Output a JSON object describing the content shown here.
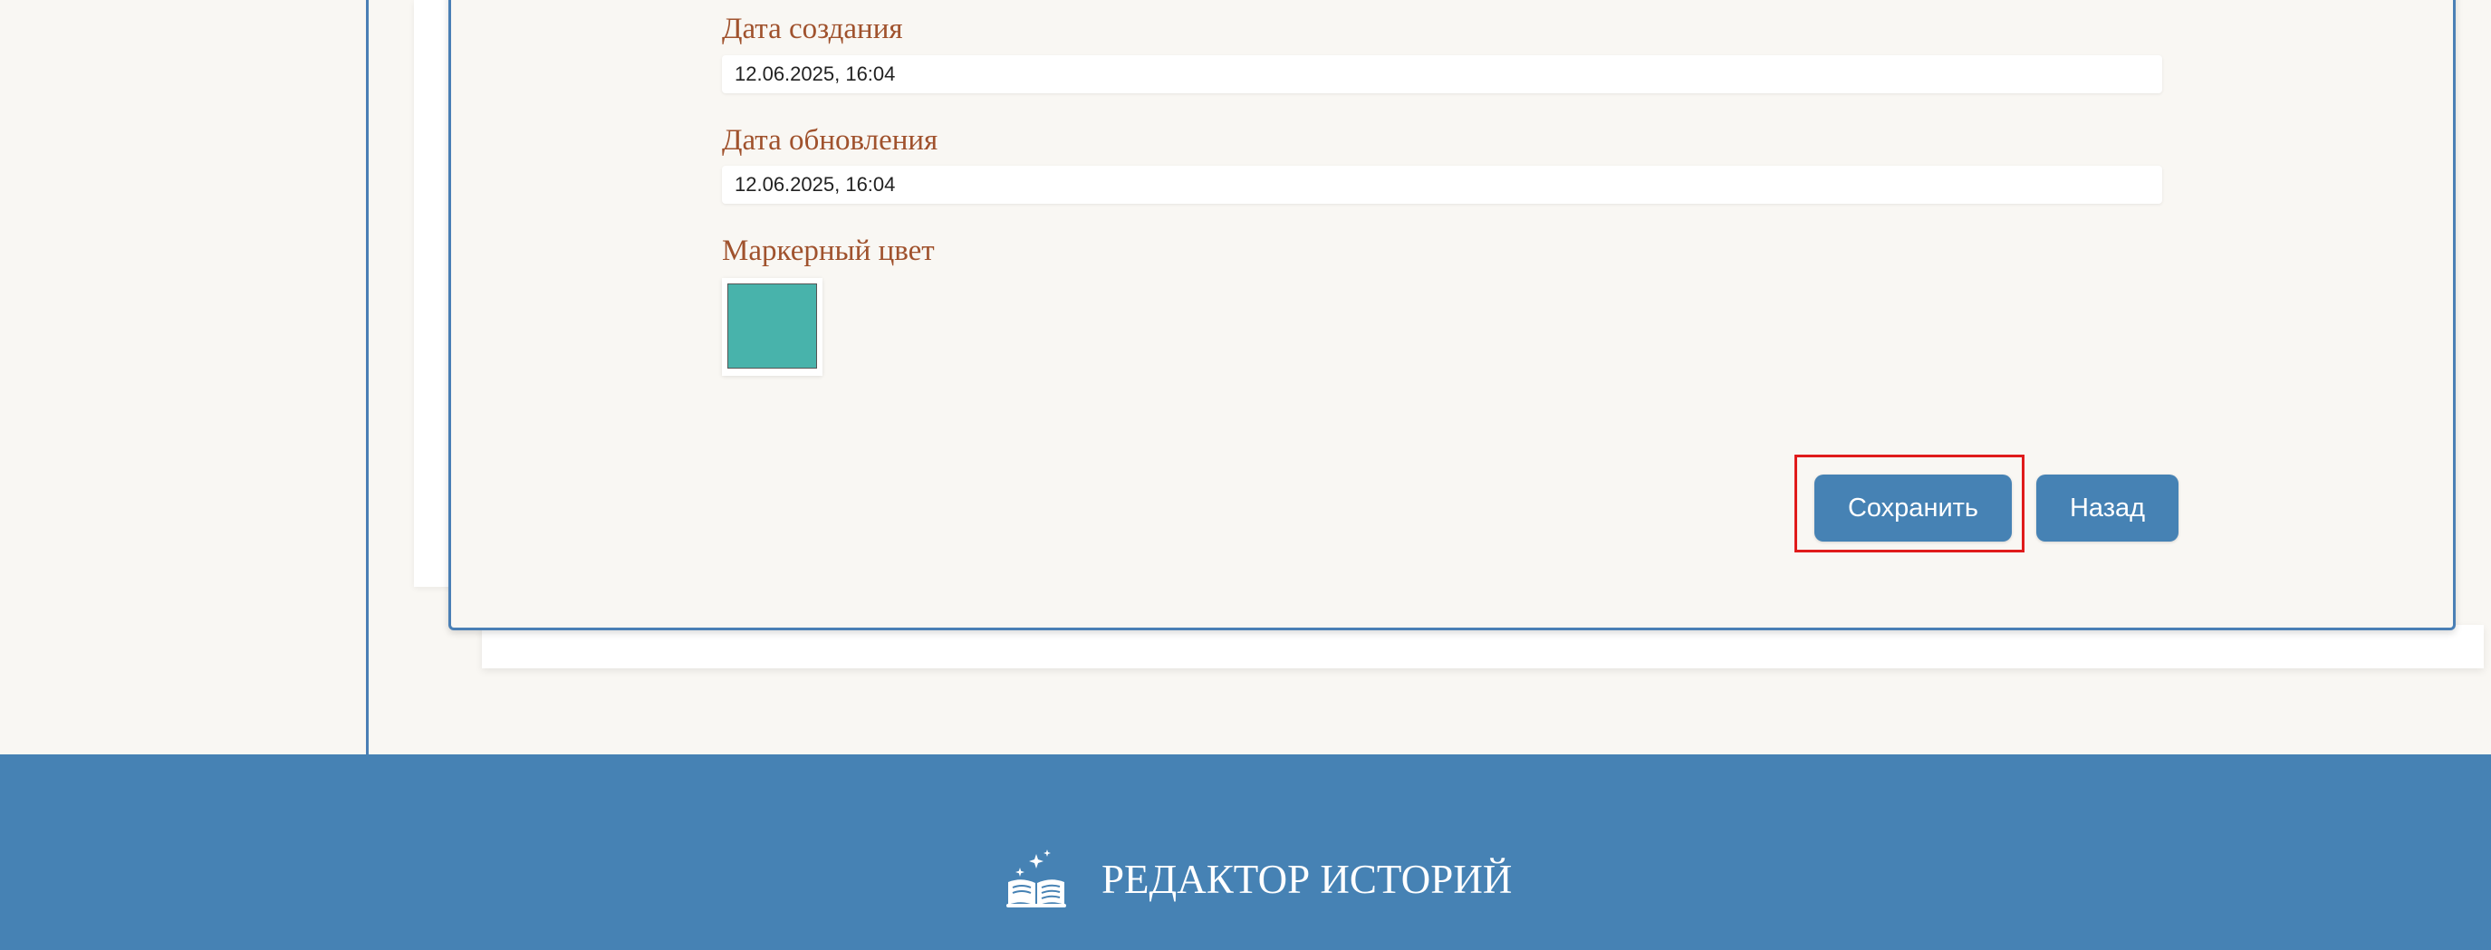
{
  "form": {
    "created": {
      "label": "Дата создания",
      "value": "12.06.2025, 16:04"
    },
    "updated": {
      "label": "Дата обновления",
      "value": "12.06.2025, 16:04"
    },
    "marker": {
      "label": "Маркерный цвет",
      "color": "#48b3ab"
    },
    "save_label": "Сохранить",
    "back_label": "Назад"
  },
  "footer": {
    "brand_name": "РЕДАКТОР ИСТОРИЙ",
    "icon": "open-book-icon"
  },
  "colors": {
    "accent": "#4682b4",
    "label": "#a0522d",
    "highlight": "#e01b1b",
    "background": "#f9f7f3"
  }
}
